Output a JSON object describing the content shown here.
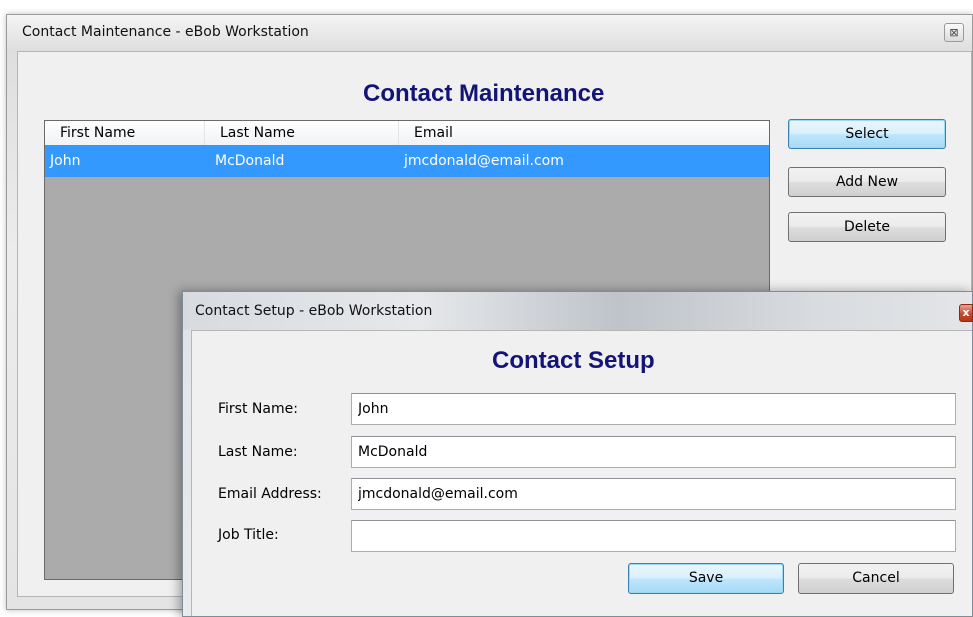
{
  "outer_window": {
    "title": "Contact Maintenance - eBob Workstation",
    "close_glyph": "⊠",
    "heading": "Contact Maintenance",
    "list": {
      "columns": [
        "First Name",
        "Last Name",
        "Email"
      ],
      "rows": [
        {
          "first": "John",
          "last": "McDonald",
          "email": "jmcdonald@email.com"
        }
      ]
    },
    "buttons": {
      "select": "Select",
      "add_new": "Add New",
      "delete": "Delete"
    }
  },
  "inner_window": {
    "title": "Contact Setup - eBob Workstation",
    "close_glyph": "x",
    "heading": "Contact Setup",
    "fields": {
      "first_name": {
        "label": "First Name:",
        "value": "John"
      },
      "last_name": {
        "label": "Last Name:",
        "value": "McDonald"
      },
      "email": {
        "label": "Email Address:",
        "value": "jmcdonald@email.com"
      },
      "job_title": {
        "label": "Job Title:",
        "value": ""
      }
    },
    "buttons": {
      "save": "Save",
      "cancel": "Cancel"
    }
  },
  "colors": {
    "heading": "#141478",
    "selection": "#3399ff",
    "list_background": "#ababab"
  }
}
